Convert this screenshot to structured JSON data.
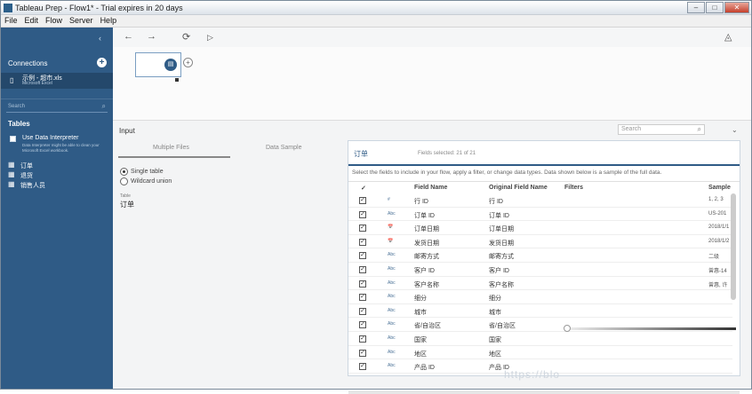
{
  "titlebar": {
    "title": "Tableau Prep - Flow1* - Trial expires in 20 days",
    "minimize": "–",
    "maximize": "□",
    "close": "✕"
  },
  "menu": [
    "File",
    "Edit",
    "Flow",
    "Server",
    "Help"
  ],
  "sidebar": {
    "collapse_icon": "‹",
    "connections_label": "Connections",
    "add_icon": "+",
    "connection": {
      "name": "示例 - 超市.xls",
      "sub": "Microsoft Excel"
    },
    "search_placeholder": "Search",
    "tables_label": "Tables",
    "interpreter_title": "Use Data Interpreter",
    "interpreter_desc": "Data Interpreter might be able to clean your Microsoft Excel workbook.",
    "tables": [
      "订单",
      "退货",
      "销售人员"
    ]
  },
  "toolbar": {
    "back": "←",
    "forward": "→",
    "refresh": "⟳",
    "run": "▷",
    "alert": "◬"
  },
  "canvas": {
    "node_icon": "▤",
    "plus": "+"
  },
  "input": {
    "title": "Input",
    "search_placeholder": "Search",
    "collapse": "⌄",
    "tabs": [
      "Multiple Files",
      "Data Sample"
    ],
    "radio_single": "Single table",
    "radio_union": "Wildcard union",
    "table_label": "Table",
    "table_value": "订单"
  },
  "grid": {
    "panel_icon": "订单",
    "field_count": "Fields selected: 21 of 21",
    "hint": "Select the fields to include in your flow, apply a filter, or change data types. Data shown below is a sample of the full data.",
    "headers": {
      "check": "✓",
      "field_name": "Field Name",
      "original": "Original Field Name",
      "filters": "Filters",
      "sample": "Sample"
    },
    "rows": [
      {
        "type": "#",
        "field": "行 ID",
        "original": "行 ID",
        "sample": "1, 2, 3"
      },
      {
        "type": "Abc",
        "field": "订单 ID",
        "original": "订单 ID",
        "sample": "US-201"
      },
      {
        "type": "📅",
        "field": "订单日期",
        "original": "订单日期",
        "sample": "2018/1/1"
      },
      {
        "type": "📅",
        "field": "发货日期",
        "original": "发货日期",
        "sample": "2018/1/2"
      },
      {
        "type": "Abc",
        "field": "邮寄方式",
        "original": "邮寄方式",
        "sample": "二级"
      },
      {
        "type": "Abc",
        "field": "客户 ID",
        "original": "客户 ID",
        "sample": "曾惠-14"
      },
      {
        "type": "Abc",
        "field": "客户名称",
        "original": "客户名称",
        "sample": "曾惠, 许"
      },
      {
        "type": "Abc",
        "field": "细分",
        "original": "细分",
        "sample": ""
      },
      {
        "type": "Abc",
        "field": "城市",
        "original": "城市",
        "sample": ""
      },
      {
        "type": "Abc",
        "field": "省/自治区",
        "original": "省/自治区",
        "sample": ""
      },
      {
        "type": "Abc",
        "field": "国家",
        "original": "国家",
        "sample": ""
      },
      {
        "type": "Abc",
        "field": "地区",
        "original": "地区",
        "sample": ""
      },
      {
        "type": "Abc",
        "field": "产品 ID",
        "original": "产品 ID",
        "sample": ""
      }
    ]
  },
  "watermark": "https://blo"
}
